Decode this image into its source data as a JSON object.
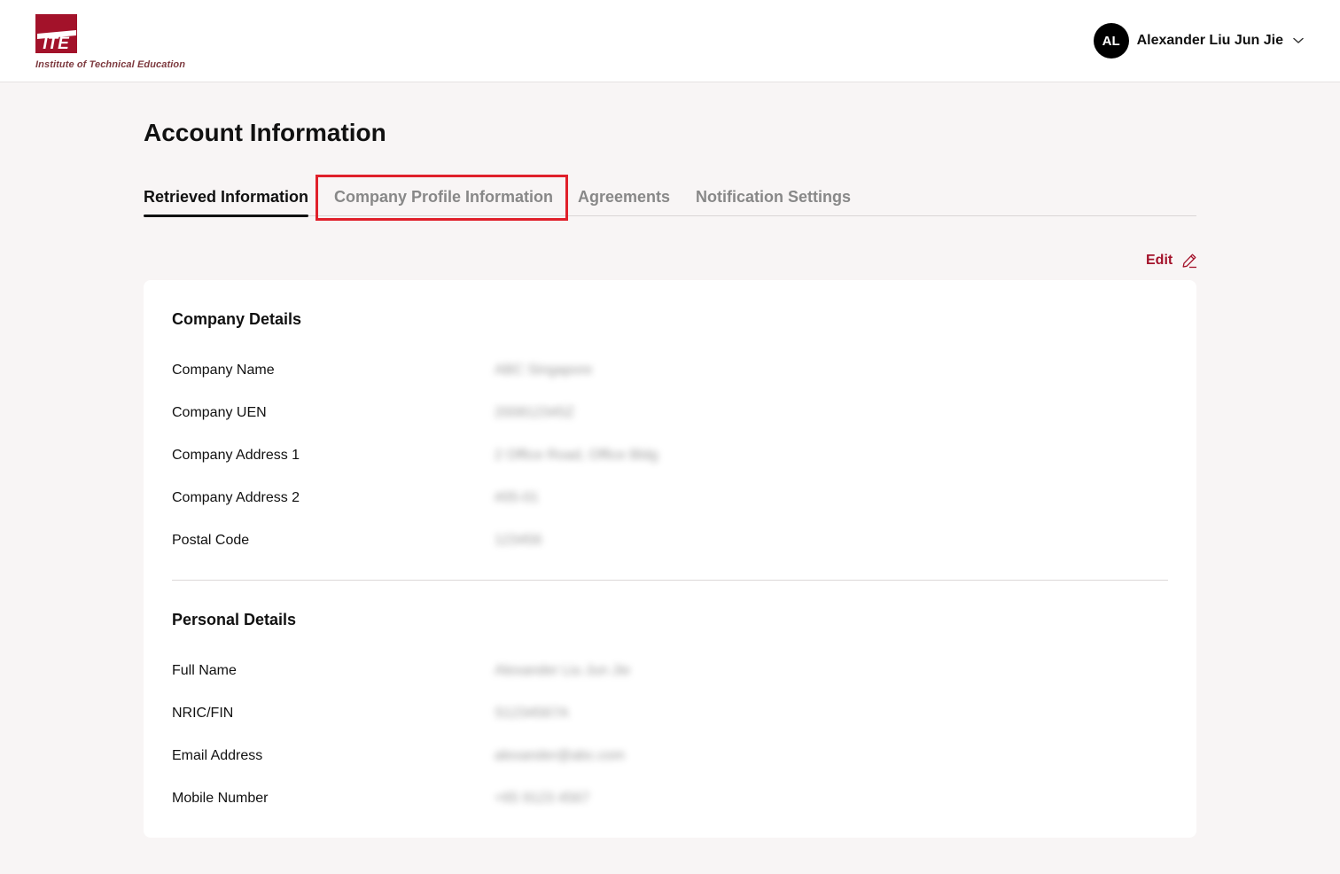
{
  "header": {
    "logo_caption": "Institute of Technical Education",
    "user_initials": "AL",
    "user_name": "Alexander Liu Jun Jie"
  },
  "page_title": "Account Information",
  "tabs": [
    {
      "label": "Retrieved Information",
      "active": true
    },
    {
      "label": "Company Profile Information",
      "active": false,
      "highlighted": true
    },
    {
      "label": "Agreements",
      "active": false
    },
    {
      "label": "Notification Settings",
      "active": false
    }
  ],
  "edit_label": "Edit",
  "company_details": {
    "title": "Company Details",
    "rows": [
      {
        "label": "Company Name",
        "value": "ABC Singapore"
      },
      {
        "label": "Company UEN",
        "value": "200812345Z"
      },
      {
        "label": "Company Address 1",
        "value": "2 Office Road, Office Bldg"
      },
      {
        "label": "Company Address 2",
        "value": "#05-01"
      },
      {
        "label": "Postal Code",
        "value": "123456"
      }
    ]
  },
  "personal_details": {
    "title": "Personal Details",
    "rows": [
      {
        "label": "Full Name",
        "value": "Alexander Liu Jun Jie"
      },
      {
        "label": "NRIC/FIN",
        "value": "S1234567A"
      },
      {
        "label": "Email Address",
        "value": "alexander@abc.com"
      },
      {
        "label": "Mobile Number",
        "value": "+65 9123 4567"
      }
    ]
  },
  "colors": {
    "brand_red": "#a3122a",
    "highlight_red": "#e0202a",
    "background": "#f8f5f5"
  }
}
